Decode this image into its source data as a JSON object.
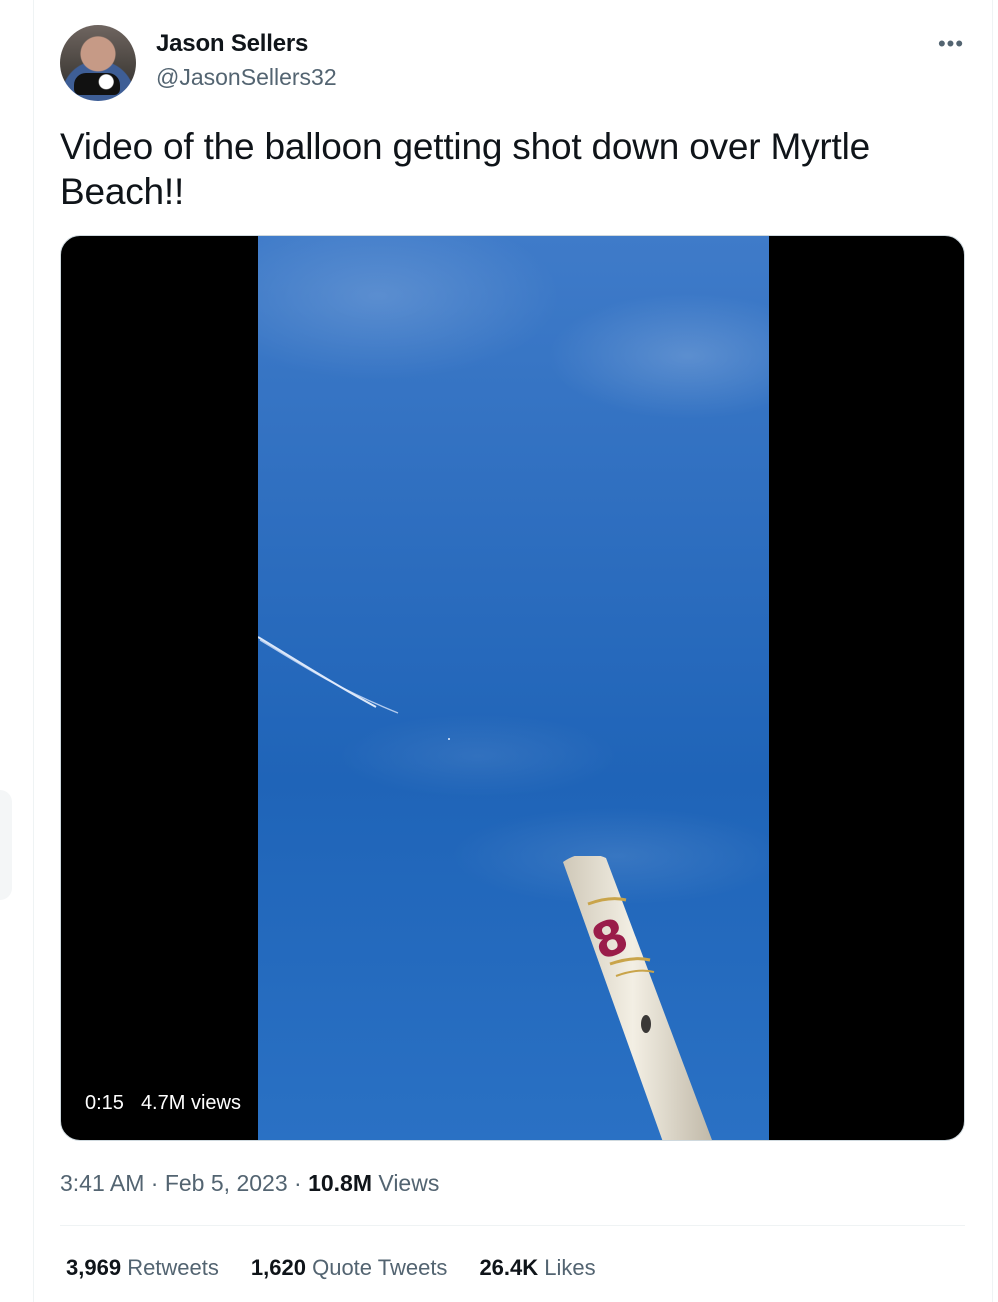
{
  "tweet": {
    "author_name": "Jason Sellers",
    "author_handle": "@JasonSellers32",
    "more_icon": "more-horizontal-icon",
    "more_glyph": "•••",
    "text": "Video of the balloon getting shot down over Myrtle Beach!!",
    "video": {
      "duration": "0:15",
      "views": "4.7M views"
    },
    "time": "3:41 AM",
    "separator": "·",
    "date": "Feb 5, 2023",
    "views_count": "10.8M",
    "views_label": "Views",
    "stats": [
      {
        "count": "3,969",
        "label": "Retweets"
      },
      {
        "count": "1,620",
        "label": "Quote Tweets"
      },
      {
        "count": "26.4K",
        "label": "Likes"
      }
    ]
  },
  "colors": {
    "text_primary": "#0f1419",
    "text_secondary": "#536471",
    "divider": "#eff3f4",
    "video_bg": "#000000",
    "sky": "#2f6fc0"
  }
}
